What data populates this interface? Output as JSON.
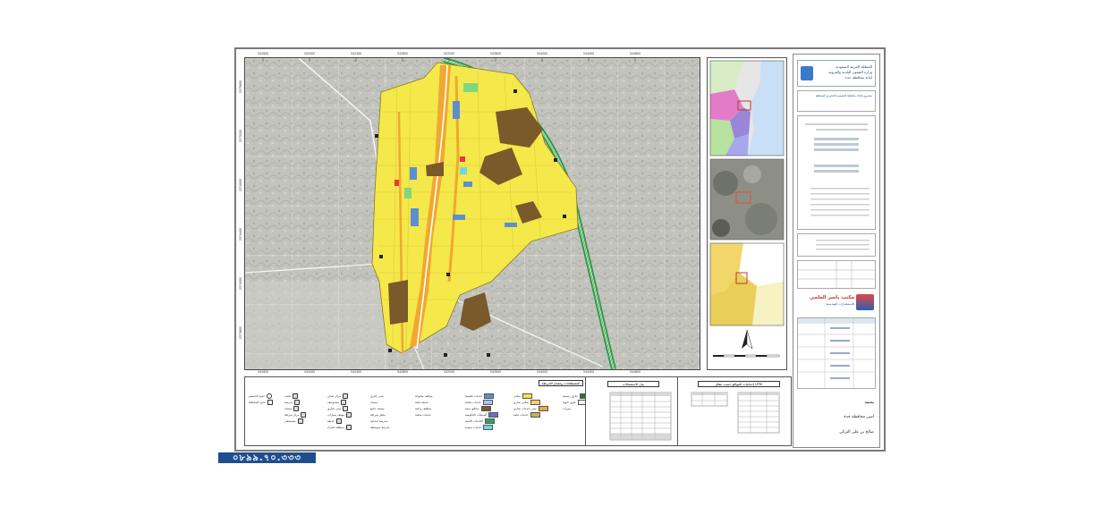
{
  "map": {
    "x_ticks": [
      "541600",
      "542000",
      "542400",
      "542800",
      "543200",
      "543600",
      "544000",
      "544400",
      "544800"
    ],
    "y_ticks": [
      "2375600",
      "2375200",
      "2374800",
      "2374400",
      "2374000",
      "2373600"
    ],
    "overlay_colors": {
      "residential": "#f4e84a",
      "commercial": "#f0a830",
      "public_open": "#7a5a2a",
      "government": "#5b8fd0",
      "park": "#7fd67f",
      "highway": "#2f9a48",
      "terrain": "#b9b9b2"
    }
  },
  "legend": {
    "title": "المصطلحات ومفتاح الخريطة",
    "col1": [
      "سكني",
      "سكني تجاري",
      "مبنى خدمات تجاري",
      "خدمات عامة"
    ],
    "col2": [
      "خدمات تعليمية",
      "خدمات صحية",
      "مناطق دينية",
      "المنشآت الحكومية",
      "الخدمات الأمنية",
      "خدمات سيدية"
    ],
    "col3": [
      "مواقف مفتوحة",
      "حديقة عامة",
      "منطقة زراعية",
      "خدمات محلية"
    ],
    "col4": [
      "مبنى إداري",
      "مسجد",
      "مسجد جامع",
      "مخفر شرطة",
      "مدرسة ابتدائية",
      "مدرسة متوسطة"
    ],
    "col5": [
      "مركز صحي",
      "مستوصف",
      "مبنى تجاري",
      "موقف سيارات",
      "حديقة",
      "منطقة خضراء"
    ],
    "col6": [
      "ملعب",
      "مدرسة",
      "مسجد",
      "مركز شرطة",
      "مستشفى"
    ],
    "col7": [
      "حدود التصميم",
      "حدود المخطط"
    ],
    "side_col": [
      "طرق رئيسية",
      "طرق ثانوية",
      "ممرات"
    ]
  },
  "stats_table": {
    "title": "بيان الاستعمالات",
    "rows": 8
  },
  "coords_table": {
    "title": "إحداثيات المواقع حسب نظام UTM"
  },
  "title_block": {
    "org_line1": "المملكة العربية السعودية",
    "org_line2": "وزارة الشئون البلدية والقروية",
    "org_line3": "أمانة محافظة جدة",
    "project": "مشروع إعداد مخطط التصميم الحضري للمنطقة",
    "company": "مكتب ياسر العلمي",
    "company_sub": "للاستشارات الهندسية",
    "approval_title": "يعتمد",
    "approver_role": "أمين محافظة جدة",
    "approver_name": "صالح بن علي التركي"
  },
  "watermark": "০৮৯৯.৭০.৩৩৩"
}
